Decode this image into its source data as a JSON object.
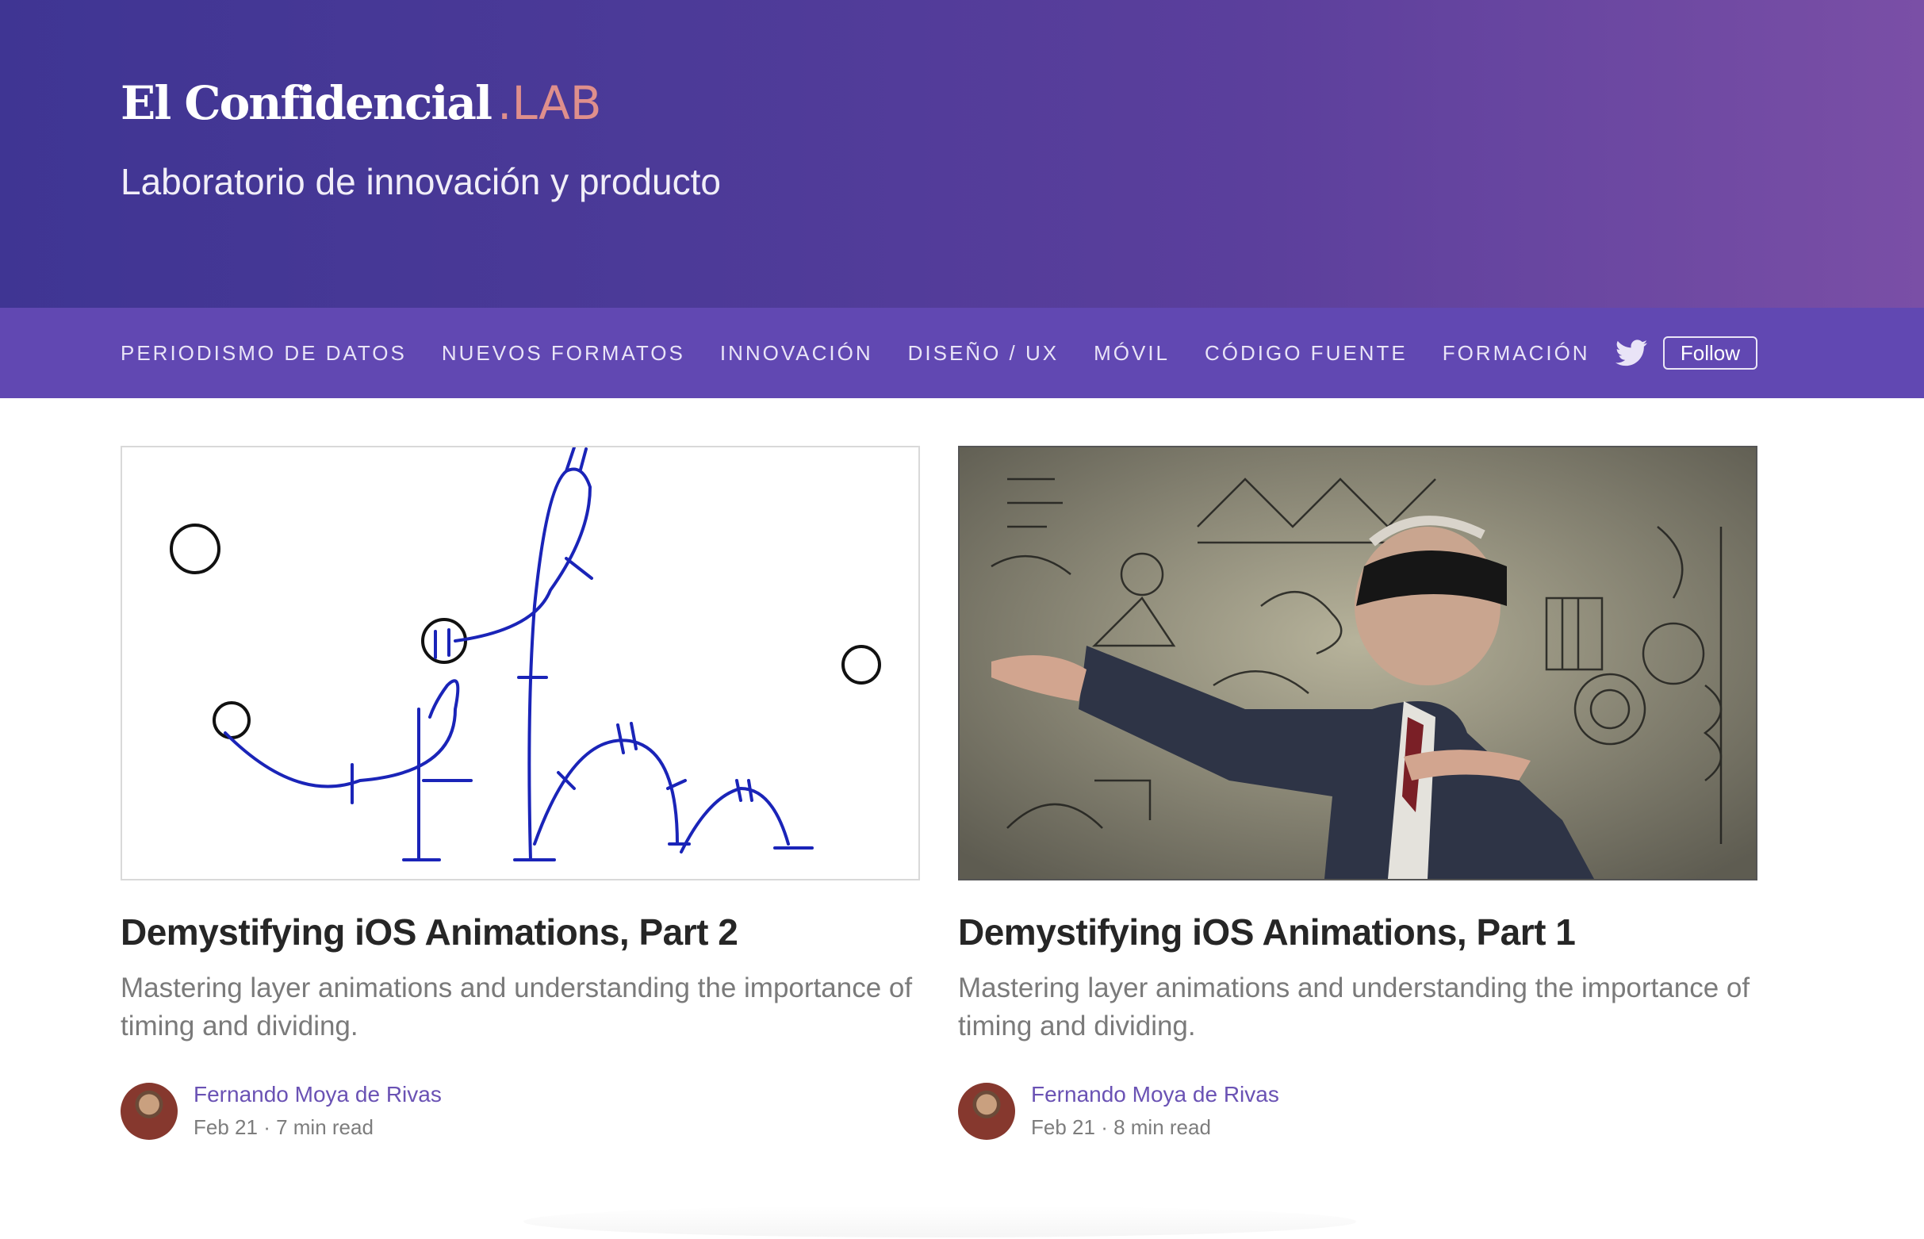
{
  "header": {
    "logo_main": "El Confidencial",
    "logo_accent": ".LAB",
    "tagline": "Laboratorio de innovación y producto",
    "colors": {
      "accent": "#df8f8c",
      "nav_bg": "#6148b2"
    }
  },
  "nav": {
    "items": [
      "PERIODISMO DE DATOS",
      "NUEVOS FORMATOS",
      "INNOVACIÓN",
      "DISEÑO / UX",
      "MÓVIL",
      "CÓDIGO FUENTE",
      "FORMACIÓN"
    ],
    "social_icon": "twitter-icon",
    "follow_label": "Follow"
  },
  "posts": [
    {
      "title": "Demystifying iOS Animations, Part 2",
      "subtitle": "Mastering layer animations and understanding the importance of timing and dividing.",
      "author": "Fernando Moya de Rivas",
      "date": "Feb 21",
      "separator": "·",
      "read_time": "7 min read"
    },
    {
      "title": "Demystifying iOS Animations, Part 1",
      "subtitle": "Mastering layer animations and understanding the importance of timing and dividing.",
      "author": "Fernando Moya de Rivas",
      "date": "Feb 21",
      "separator": "·",
      "read_time": "8 min read"
    }
  ]
}
